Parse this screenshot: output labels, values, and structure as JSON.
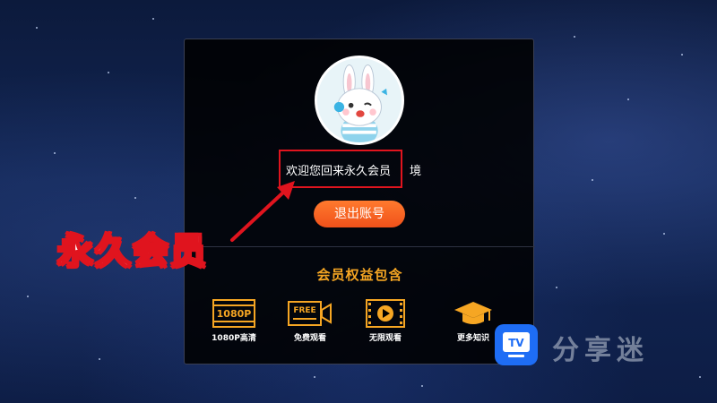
{
  "account": {
    "welcome_text": "欢迎您回来永久会员",
    "welcome_suffix": "境",
    "logout_label": "退出账号"
  },
  "benefits": {
    "title": "会员权益包含",
    "items": [
      {
        "label": "1080P高清",
        "icon": "1080p-icon",
        "icon_text": "1080P"
      },
      {
        "label": "免费观看",
        "icon": "free-video-icon",
        "icon_text": "FREE"
      },
      {
        "label": "无限观看",
        "icon": "film-play-icon"
      },
      {
        "label": "更多知识",
        "icon": "graduation-cap-icon"
      }
    ]
  },
  "annotation": {
    "big_label": "永久会员"
  },
  "watermark": {
    "logo_text": "TV",
    "brand": "分享迷"
  },
  "colors": {
    "accent_orange": "#f0511a",
    "benefit_gold": "#f6a623",
    "annotation_red": "#e0141e",
    "logo_blue": "#1e6df5"
  }
}
